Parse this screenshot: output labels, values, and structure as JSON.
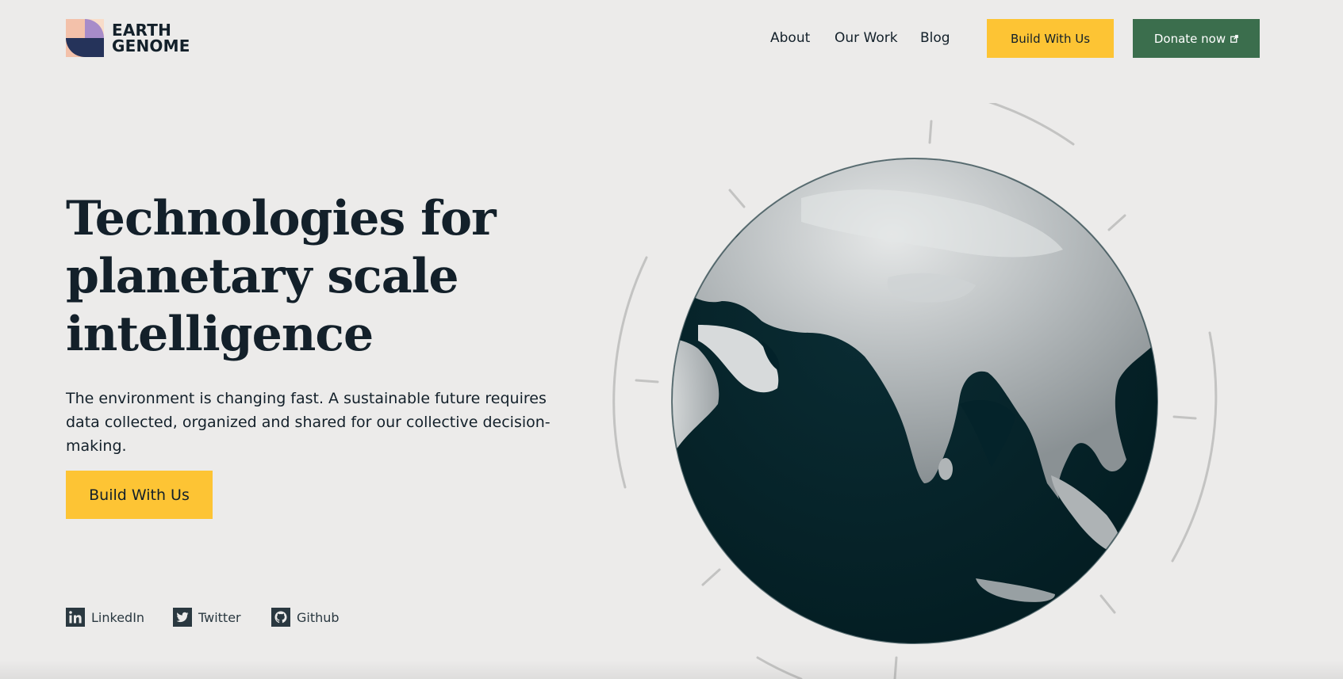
{
  "brand": {
    "line1": "EARTH",
    "line2": "GENOME",
    "colors": {
      "peach": "#f3c1aa",
      "lavender": "#a78cc9",
      "navy": "#25335a",
      "cream": "#f8dcc9"
    }
  },
  "nav": {
    "items": [
      {
        "label": "About"
      },
      {
        "label": "Our Work"
      },
      {
        "label": "Blog"
      }
    ],
    "cta_primary": "Build With Us",
    "cta_donate": "Donate now"
  },
  "hero": {
    "title_line1": "Technologies for",
    "title_line2": "planetary scale",
    "title_line3": "intelligence",
    "description": "The environment is changing fast. A sustainable future requires data collected, organized and shared for our collective decision-making.",
    "cta": "Build With Us"
  },
  "social": [
    {
      "label": "LinkedIn",
      "icon": "linkedin-icon"
    },
    {
      "label": "Twitter",
      "icon": "twitter-icon"
    },
    {
      "label": "Github",
      "icon": "github-icon"
    }
  ],
  "colors": {
    "background": "#ecebea",
    "text": "#13202a",
    "yellow": "#fdc434",
    "green": "#3b6e4d",
    "ocean": "#04232a"
  }
}
